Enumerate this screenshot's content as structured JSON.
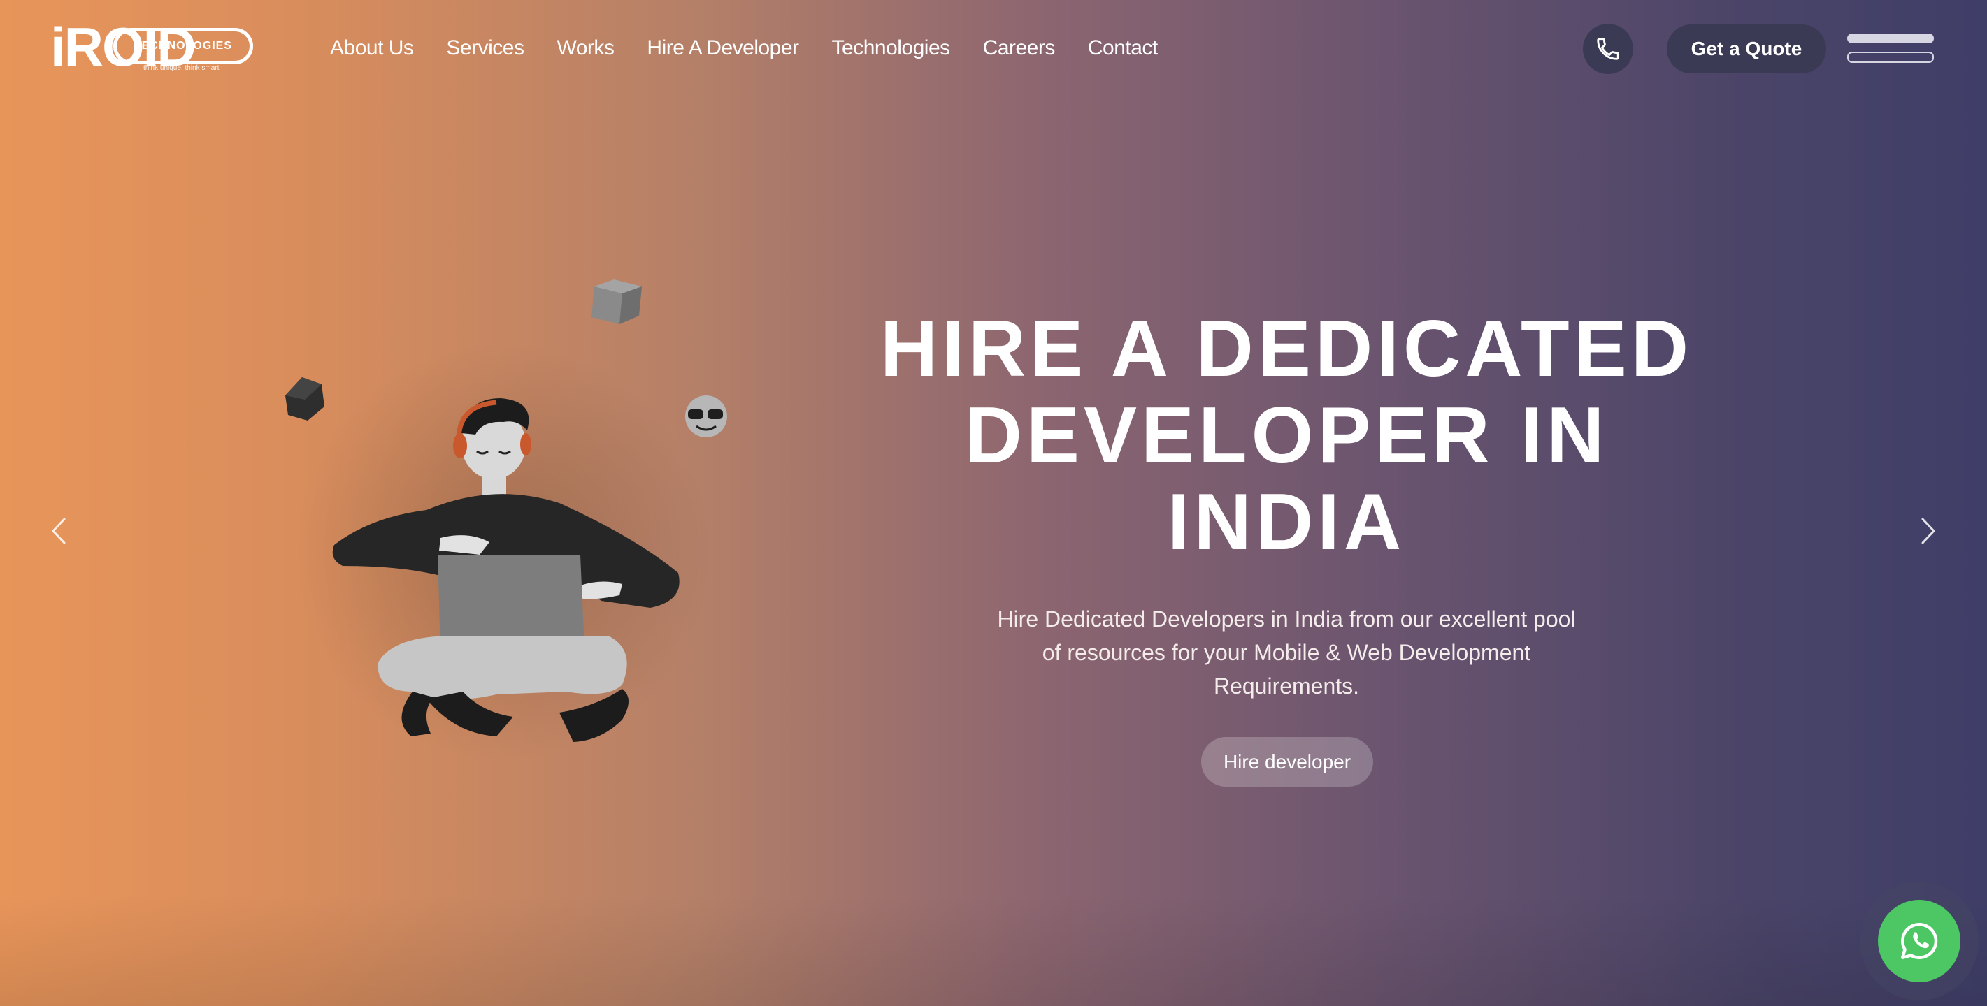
{
  "brand": {
    "logo_word": "iROID",
    "logo_sub": "TECHNOLOGIES",
    "tagline": "think unique. think smart"
  },
  "nav": {
    "items": [
      {
        "label": "About Us"
      },
      {
        "label": "Services"
      },
      {
        "label": "Works"
      },
      {
        "label": "Hire A Developer"
      },
      {
        "label": "Technologies"
      },
      {
        "label": "Careers"
      },
      {
        "label": "Contact"
      }
    ]
  },
  "header": {
    "quote_label": "Get a Quote",
    "phone_icon": "phone-icon",
    "menu_icon": "hamburger-menu-icon"
  },
  "hero": {
    "title": "HIRE A DEDICATED DEVELOPER IN INDIA",
    "description": "Hire Dedicated Developers in India from our excellent pool of resources for your Mobile & Web Development Requirements.",
    "cta_label": "Hire developer"
  },
  "slider": {
    "prev_icon": "chevron-left-icon",
    "next_icon": "chevron-right-icon"
  },
  "floating": {
    "whatsapp_icon": "whatsapp-icon"
  },
  "colors": {
    "gradient_start": "#e8955a",
    "gradient_end": "#3f3e68",
    "button_dark": "#3b3a55",
    "whatsapp_green": "#4cc764"
  }
}
